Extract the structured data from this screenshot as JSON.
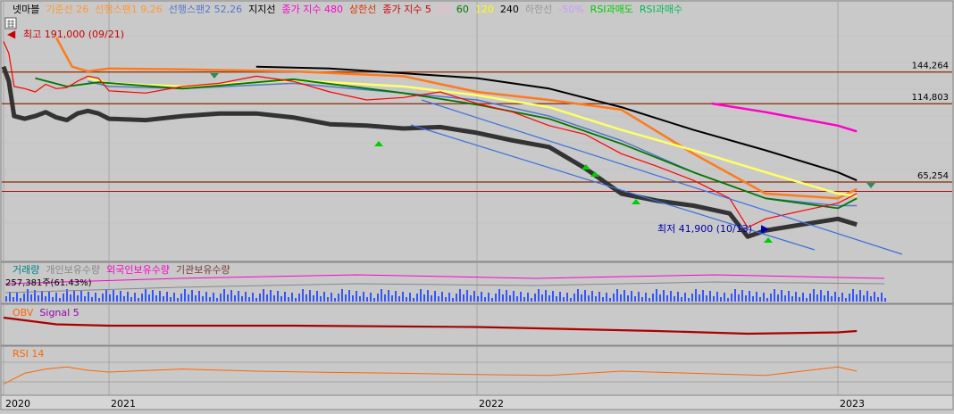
{
  "chart_data": {
    "type": "line",
    "stock_name": "넷마블",
    "main_legend": [
      {
        "text": "넷마블",
        "color": "#000000"
      },
      {
        "text": "기준선 26",
        "color": "#ff9933"
      },
      {
        "text": "선행스팬1 9,26",
        "color": "#ff9933"
      },
      {
        "text": "선행스팬2 52,26",
        "color": "#5577cc"
      },
      {
        "text": "지지선",
        "color": "#000000"
      },
      {
        "text": "종가 지수 480",
        "color": "#ff00cc"
      },
      {
        "text": "상한선",
        "color": "#dd3300"
      },
      {
        "text": "종가 지수 5",
        "color": "#cc0000"
      },
      {
        "text": "20",
        "color": "#ffb0d0"
      },
      {
        "text": "60",
        "color": "#007700"
      },
      {
        "text": "120",
        "color": "#ffff00"
      },
      {
        "text": "240",
        "color": "#000000"
      },
      {
        "text": "하한선",
        "color": "#999999"
      },
      {
        "text": "-50%",
        "color": "#cc99ff"
      },
      {
        "text": "RSI과매도",
        "color": "#00cc00"
      },
      {
        "text": "RSI과매수",
        "color": "#00bb55"
      }
    ],
    "annotations": {
      "high": "최고 191,000 (09/21)",
      "low": "최저 41,900 (10/13)"
    },
    "horizontal_levels": [
      {
        "label": "144,264",
        "value": 144264
      },
      {
        "label": "114,803",
        "value": 114803
      },
      {
        "label": "65,254",
        "value": 65254
      }
    ],
    "x_axis": {
      "labels": [
        {
          "text": "2020",
          "t": 0.0
        },
        {
          "text": "2021",
          "t": 1.0
        },
        {
          "text": "2022",
          "t": 2.0
        },
        {
          "text": "2023",
          "t": 3.0
        }
      ]
    },
    "series": [
      {
        "name": "넷마블",
        "color": "#ff0000",
        "t": [
          0.0,
          0.05,
          0.1,
          0.2,
          0.3,
          0.4,
          0.5,
          0.6,
          0.7,
          0.8,
          0.9,
          1.0,
          1.1,
          1.2,
          1.3,
          1.4,
          1.5,
          1.6,
          1.7,
          1.8,
          1.9,
          2.0,
          2.1,
          2.2,
          2.3,
          2.4,
          2.5,
          2.6,
          2.7,
          2.75,
          2.8,
          2.9,
          3.0,
          3.1
        ],
        "values": [
          180000,
          165000,
          130000,
          128000,
          125000,
          132000,
          128000,
          129000,
          135000,
          140000,
          138000,
          126000,
          124000,
          130000,
          133000,
          140000,
          135000,
          125000,
          118000,
          120000,
          125000,
          115000,
          108000,
          98000,
          92000,
          80000,
          73000,
          66000,
          58000,
          47000,
          50000,
          53000,
          56000,
          60000
        ]
      },
      {
        "name": "지지선",
        "color": "#333333",
        "t": [
          0.0,
          0.05,
          0.1,
          0.2,
          0.3,
          0.4,
          0.5,
          0.6,
          0.7,
          0.8,
          0.9,
          1.0,
          1.1,
          1.2,
          1.3,
          1.4,
          1.5,
          1.6,
          1.7,
          1.8,
          1.9,
          2.0,
          2.1,
          2.2,
          2.3,
          2.4,
          2.5,
          2.6,
          2.7,
          2.75,
          2.8,
          2.9,
          3.0,
          3.1
        ],
        "values": [
          150000,
          135000,
          105000,
          103000,
          105000,
          108000,
          104000,
          102000,
          107000,
          109000,
          107000,
          103000,
          102000,
          105000,
          107000,
          107000,
          104000,
          99000,
          98000,
          96000,
          97000,
          93000,
          88000,
          84000,
          72000,
          60000,
          57000,
          55000,
          52000,
          44000,
          46000,
          48000,
          50000,
          48000
        ]
      },
      {
        "name": "240",
        "color": "#000000",
        "t": [
          1.4,
          1.6,
          1.8,
          2.0,
          2.2,
          2.4,
          2.6,
          2.8,
          3.0,
          3.1
        ],
        "values": [
          150000,
          148000,
          143000,
          138000,
          128000,
          112000,
          95000,
          82000,
          70000,
          66000
        ]
      },
      {
        "name": "종가 지수 480",
        "color": "#ff00cc",
        "t": [
          2.65,
          2.8,
          3.0,
          3.1
        ],
        "values": [
          115000,
          108000,
          98000,
          94000
        ]
      },
      {
        "name": "120",
        "color": "#ffff66",
        "t": [
          0.8,
          1.0,
          1.2,
          1.5,
          1.8,
          2.0,
          2.2,
          2.4,
          2.6,
          2.8,
          3.0,
          3.1
        ],
        "values": [
          138000,
          133000,
          130000,
          136000,
          130000,
          122000,
          112000,
          95000,
          82000,
          70000,
          60000,
          59000
        ]
      },
      {
        "name": "60",
        "color": "#007700",
        "t": [
          0.3,
          0.6,
          0.9,
          1.2,
          1.5,
          1.8,
          2.0,
          2.2,
          2.4,
          2.6,
          2.8,
          3.0,
          3.1
        ],
        "values": [
          138000,
          130000,
          134000,
          128000,
          137000,
          124000,
          114000,
          103000,
          86000,
          70000,
          58000,
          54000,
          58000
        ]
      },
      {
        "name": "기준선 26",
        "color": "#ff7a1a",
        "t": [
          0.5,
          0.65,
          0.8,
          1.0,
          1.2,
          1.5,
          1.8,
          2.0,
          2.2,
          2.4,
          2.6,
          2.8,
          3.0,
          3.1
        ],
        "values": [
          185000,
          150000,
          145000,
          148000,
          147000,
          145000,
          140000,
          125000,
          118000,
          110000,
          80000,
          60000,
          58000,
          62000
        ]
      },
      {
        "name": "선행스팬2 52,26",
        "color": "#5577cc",
        "t": [
          0.8,
          1.0,
          1.2,
          1.5,
          1.8,
          2.0,
          2.2,
          2.4,
          2.6,
          2.8,
          3.0,
          3.1
        ],
        "values": [
          135000,
          130000,
          128000,
          133000,
          124000,
          118000,
          105000,
          88000,
          70000,
          58000,
          55000,
          55000
        ]
      },
      {
        "name": "OBV",
        "color": "#aa0000",
        "t": [
          0.0,
          0.5,
          1.0,
          1.5,
          2.0,
          2.5,
          2.75,
          3.0,
          3.1
        ],
        "values": [
          0.8,
          0.55,
          0.5,
          0.5,
          0.45,
          0.3,
          0.2,
          0.25,
          0.3
        ]
      },
      {
        "name": "RSI 14",
        "color": "#ff6600",
        "t": [
          0.0,
          0.2,
          0.4,
          0.6,
          0.8,
          1.0,
          1.2,
          1.4,
          1.6,
          1.8,
          2.0,
          2.2,
          2.4,
          2.6,
          2.8,
          3.0,
          3.1
        ],
        "values": [
          20,
          45,
          55,
          60,
          52,
          48,
          55,
          50,
          47,
          45,
          42,
          40,
          50,
          45,
          40,
          60,
          50
        ]
      }
    ],
    "volume_panel": {
      "legend": [
        {
          "text": "거래량",
          "color": "#008080"
        },
        {
          "text": "개인보유수량",
          "color": "#888888"
        },
        {
          "text": "외국인보유수량",
          "color": "#ff00cc"
        },
        {
          "text": "기관보유수량",
          "color": "#7a3a3a"
        }
      ],
      "readout": "257,381주(61.43%)"
    },
    "obv_panel": {
      "legend": [
        {
          "text": "OBV",
          "color": "#ff6600"
        },
        {
          "text": "Signal 5",
          "color": "#9900aa"
        }
      ]
    },
    "rsi_panel": {
      "legend": [
        {
          "text": "RSI 14",
          "color": "#ff6600"
        }
      ]
    }
  }
}
